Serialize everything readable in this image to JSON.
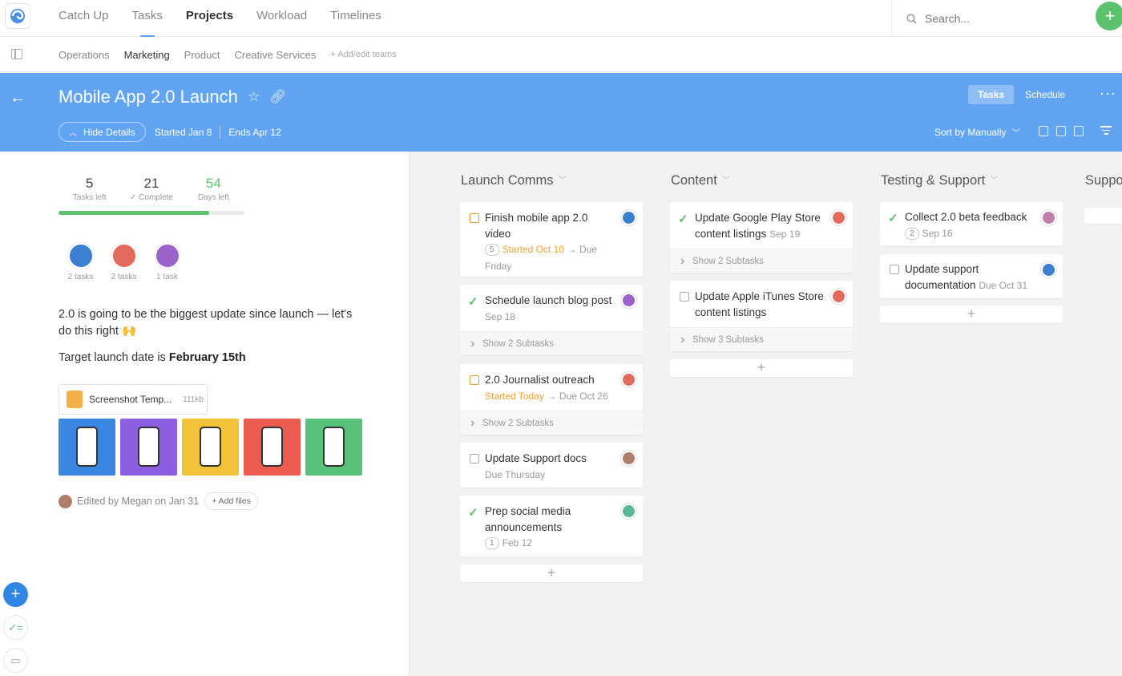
{
  "nav": {
    "items": [
      "Catch Up",
      "Tasks",
      "Projects",
      "Workload",
      "Timelines"
    ],
    "search_placeholder": "Search..."
  },
  "teams": {
    "items": [
      "Operations",
      "Marketing",
      "Product",
      "Creative Services"
    ],
    "add_label": "+ Add/edit teams"
  },
  "project": {
    "title": "Mobile App 2.0 Launch",
    "hide_details": "Hide Details",
    "started": "Started Jan 8",
    "ends": "Ends Apr 12",
    "view_tabs": [
      "Tasks",
      "Schedule"
    ],
    "sort_label": "Sort by Manually"
  },
  "stats": {
    "tasks_left": "5",
    "tasks_left_label": "Tasks left",
    "complete": "21",
    "complete_label": "Complete",
    "days_left": "54",
    "days_left_label": "Days left",
    "progress_fraction": 0.81
  },
  "assignees": [
    "2 tasks",
    "2 tasks",
    "1 task"
  ],
  "description": {
    "line1": "2.0 is going to be the biggest update since launch — let's do this right 🙌",
    "line2_prefix": "Target launch date is ",
    "line2_bold": "February 15th"
  },
  "file": {
    "name": "Screenshot Temp...",
    "size": "111kb"
  },
  "thumb_colors": [
    "#3a86e0",
    "#8c5ee0",
    "#f2c23a",
    "#ec5b4f",
    "#58c27a"
  ],
  "edited": {
    "text": "Edited by Megan on Jan 31",
    "add_files": "+ Add files"
  },
  "columns": {
    "c1": {
      "title": "Launch Comms",
      "cards": [
        {
          "title": "Finish mobile app 2.0 video",
          "badge": "5",
          "meta_orange": "Started Oct 10",
          "meta": "→ Due Friday"
        },
        {
          "title": "Schedule launch blog post",
          "meta": "Sep 18",
          "subtasks": "Show 2 Subtasks"
        },
        {
          "title": "2.0 Journalist outreach",
          "meta_orange": "Started Today",
          "meta": "→ Due Oct 26",
          "subtasks": "Show 2 Subtasks"
        },
        {
          "title": "Update Support docs",
          "meta": "Due Thursday"
        },
        {
          "title": "Prep social media announcements",
          "badge": "1",
          "meta": "Feb 12"
        }
      ]
    },
    "c2": {
      "title": "Content",
      "cards": [
        {
          "title": "Update Google Play Store content listings",
          "meta": "Sep 19",
          "subtasks": "Show 2 Subtasks"
        },
        {
          "title": "Update Apple iTunes Store content listings",
          "subtasks": "Show 3 Subtasks"
        }
      ]
    },
    "c3": {
      "title": "Testing & Support",
      "cards": [
        {
          "title": "Collect 2.0 beta feedback",
          "badge": "2",
          "meta": "Sep 16"
        },
        {
          "title": "Update support documentation",
          "meta": "Due Oct 31"
        }
      ]
    },
    "c4": {
      "title": "Suppo"
    }
  },
  "colors": {
    "header_blue": "#61a5f2",
    "green": "#5dc26d",
    "orange": "#f0a030"
  }
}
